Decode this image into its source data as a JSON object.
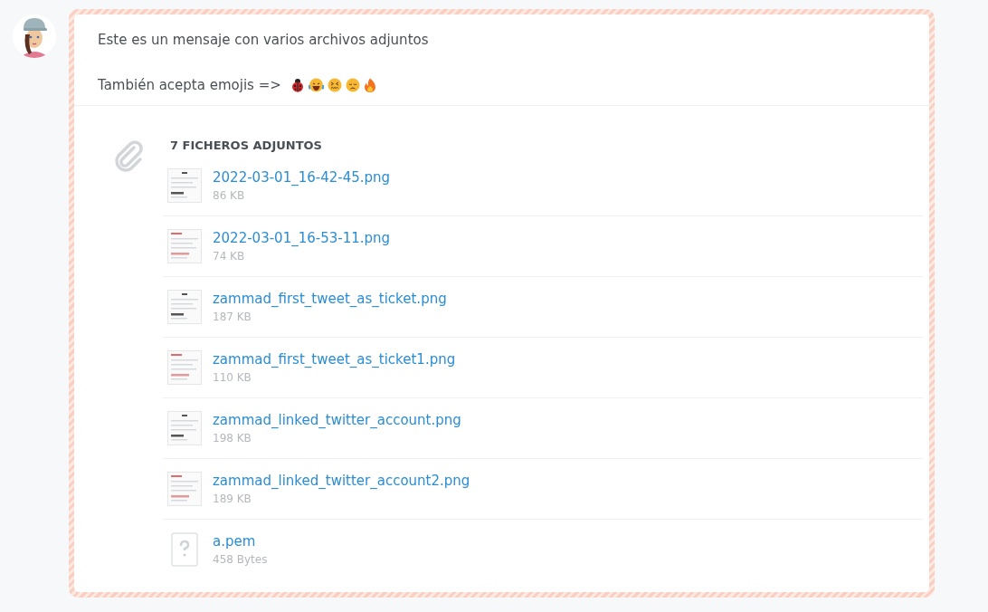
{
  "message": {
    "lines": [
      "Este es un mensaje con varios archivos adjuntos",
      "También acepta emojis   =>"
    ]
  },
  "attachments": {
    "heading": "7 FICHEROS ADJUNTOS",
    "files": [
      {
        "kind": "image",
        "name": "2022-03-01_16-42-45.png",
        "size": "86 KB"
      },
      {
        "kind": "image",
        "name": "2022-03-01_16-53-11.png",
        "size": "74 KB"
      },
      {
        "kind": "image",
        "name": "zammad_first_tweet_as_ticket.png",
        "size": "187 KB"
      },
      {
        "kind": "image",
        "name": "zammad_first_tweet_as_ticket1.png",
        "size": "110 KB"
      },
      {
        "kind": "image",
        "name": "zammad_linked_twitter_account.png",
        "size": "198 KB"
      },
      {
        "kind": "image",
        "name": "zammad_linked_twitter_account2.png",
        "size": "189 KB"
      },
      {
        "kind": "file",
        "name": "a.pem",
        "size": "458 Bytes"
      }
    ]
  }
}
